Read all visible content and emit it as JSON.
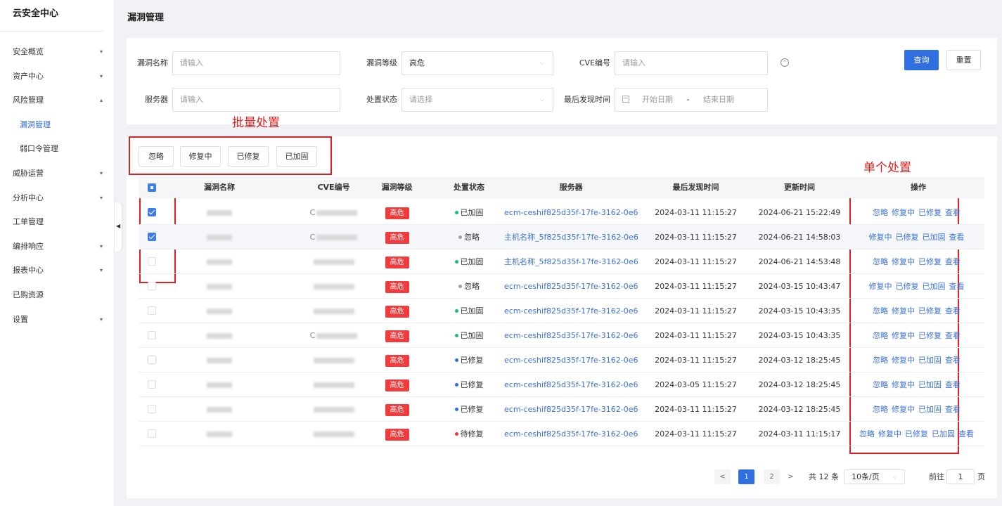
{
  "sidebar": {
    "title": "云安全中心",
    "items": [
      {
        "label": "安全概览",
        "chevron": "▾"
      },
      {
        "label": "资产中心",
        "chevron": "▾"
      },
      {
        "label": "风险管理",
        "chevron": "▴"
      },
      {
        "label": "漏洞管理",
        "chevron": ""
      },
      {
        "label": "弱口令管理",
        "chevron": ""
      },
      {
        "label": "威胁运营",
        "chevron": "▾"
      },
      {
        "label": "分析中心",
        "chevron": "▾"
      },
      {
        "label": "工单管理",
        "chevron": ""
      },
      {
        "label": "编排响应",
        "chevron": "▾"
      },
      {
        "label": "报表中心",
        "chevron": "▾"
      },
      {
        "label": "已购资源",
        "chevron": ""
      },
      {
        "label": "设置",
        "chevron": "▾"
      }
    ],
    "collapse_glyph": "◀"
  },
  "page_title": "漏洞管理",
  "filters": {
    "vuln_name_label": "漏洞名称",
    "vuln_name_placeholder": "请输入",
    "level_label": "漏洞等级",
    "level_value": "高危",
    "cve_label": "CVE编号",
    "cve_placeholder": "请输入",
    "server_label": "服务器",
    "server_placeholder": "请输入",
    "status_label": "处置状态",
    "status_placeholder": "请选择",
    "last_found_label": "最后发现时间",
    "start_date": "开始日期",
    "date_sep": "-",
    "end_date": "结束日期",
    "dropdown_glyph": "⌵",
    "expand_glyph": "⌃",
    "query_button": "查询",
    "reset_button": "重置"
  },
  "batch": {
    "buttons": [
      "忽略",
      "修复中",
      "已修复",
      "已加固"
    ]
  },
  "annotations": {
    "batch_label": "批量处置",
    "single_label": "单个处置"
  },
  "table": {
    "headers": [
      "漏洞名称",
      "CVE编号",
      "漏洞等级",
      "处置状态",
      "服务器",
      "最后发现时间",
      "更新时间",
      "操作"
    ],
    "rows": [
      {
        "checked": true,
        "level": "高危",
        "status": "已加固",
        "status_color": "#19be6b",
        "server": "ecm-ceshif825d35f-17fe-3162-0e68-...",
        "last_found": "2024-03-11 11:15:27",
        "updated": "2024-06-21 15:22:49",
        "ops": [
          "忽略",
          "修复中",
          "已修复",
          "查看"
        ],
        "cve_prefix": "C"
      },
      {
        "checked": true,
        "level": "高危",
        "status": "忽略",
        "status_color": "#a0a0a0",
        "server": "主机名称_5f825d35f-17fe-3162-0e68...",
        "last_found": "2024-03-11 11:15:27",
        "updated": "2024-06-21 14:58:03",
        "ops": [
          "修复中",
          "已修复",
          "已加固",
          "查看"
        ],
        "cve_prefix": "C"
      },
      {
        "checked": false,
        "level": "高危",
        "status": "已加固",
        "status_color": "#19be6b",
        "server": "主机名称_5f825d35f-17fe-3162-0e68...",
        "last_found": "2024-03-11 11:15:27",
        "updated": "2024-06-21 14:53:48",
        "ops": [
          "忽略",
          "修复中",
          "已修复",
          "查看"
        ],
        "cve_prefix": ""
      },
      {
        "checked": false,
        "level": "高危",
        "status": "忽略",
        "status_color": "#a0a0a0",
        "server": "ecm-ceshif825d35f-17fe-3162-0e68-...",
        "last_found": "2024-03-11 11:15:27",
        "updated": "2024-03-15 10:43:47",
        "ops": [
          "修复中",
          "已修复",
          "已加固",
          "查看"
        ],
        "cve_prefix": ""
      },
      {
        "checked": false,
        "level": "高危",
        "status": "已加固",
        "status_color": "#19be6b",
        "server": "ecm-ceshif825d35f-17fe-3162-0e68-...",
        "last_found": "2024-03-11 11:15:27",
        "updated": "2024-03-15 10:43:35",
        "ops": [
          "忽略",
          "修复中",
          "已修复",
          "查看"
        ],
        "cve_prefix": ""
      },
      {
        "checked": false,
        "level": "高危",
        "status": "已加固",
        "status_color": "#19be6b",
        "server": "ecm-ceshif825d35f-17fe-3162-0e68-...",
        "last_found": "2024-03-11 11:15:27",
        "updated": "2024-03-15 10:43:35",
        "ops": [
          "忽略",
          "修复中",
          "已修复",
          "查看"
        ],
        "cve_prefix": "C"
      },
      {
        "checked": false,
        "level": "高危",
        "status": "已修复",
        "status_color": "#2f6fe0",
        "server": "ecm-ceshif825d35f-17fe-3162-0e68-...",
        "last_found": "2024-03-11 11:15:27",
        "updated": "2024-03-12 18:25:45",
        "ops": [
          "忽略",
          "修复中",
          "已加固",
          "查看"
        ],
        "cve_prefix": ""
      },
      {
        "checked": false,
        "level": "高危",
        "status": "已修复",
        "status_color": "#2f6fe0",
        "server": "ecm-ceshif825d35f-17fe-3162-0e68-...",
        "last_found": "2024-03-05 11:15:27",
        "updated": "2024-03-12 18:25:45",
        "ops": [
          "忽略",
          "修复中",
          "已加固",
          "查看"
        ],
        "cve_prefix": ""
      },
      {
        "checked": false,
        "level": "高危",
        "status": "已修复",
        "status_color": "#2f6fe0",
        "server": "ecm-ceshif825d35f-17fe-3162-0e68-...",
        "last_found": "2024-03-11 11:15:27",
        "updated": "2024-03-12 18:25:45",
        "ops": [
          "忽略",
          "修复中",
          "已加固",
          "查看"
        ],
        "cve_prefix": ""
      },
      {
        "checked": false,
        "level": "高危",
        "status": "待修复",
        "status_color": "#f03c3c",
        "server": "ecm-ceshif825d35f-17fe-3162-0e68-...",
        "last_found": "2024-03-11 11:15:27",
        "updated": "2024-03-11 11:15:17",
        "ops": [
          "忽略",
          "修复中",
          "已修复",
          "已加固",
          "查看"
        ],
        "cve_prefix": ""
      }
    ]
  },
  "pagination": {
    "prev": "<",
    "pages": [
      "1",
      "2"
    ],
    "current": "1",
    "next": ">",
    "total_text": "共 12 条",
    "page_size": "10条/页",
    "goto_label": "前往",
    "goto_value": "1",
    "page_suffix": "页"
  },
  "colors": {
    "primary": "#2f6fe0",
    "danger": "#f03c3c",
    "annotation": "#e02020"
  }
}
